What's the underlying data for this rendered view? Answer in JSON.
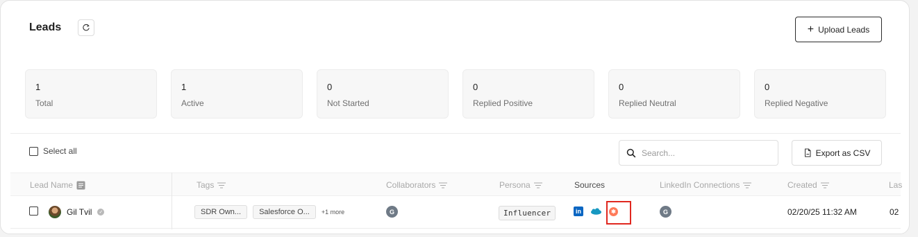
{
  "header": {
    "title": "Leads",
    "upload_label": "Upload Leads"
  },
  "stats": [
    {
      "value": "1",
      "label": "Total"
    },
    {
      "value": "1",
      "label": "Active"
    },
    {
      "value": "0",
      "label": "Not Started"
    },
    {
      "value": "0",
      "label": "Replied Positive"
    },
    {
      "value": "0",
      "label": "Replied Neutral"
    },
    {
      "value": "0",
      "label": "Replied Negative"
    }
  ],
  "toolbar": {
    "select_all_label": "Select all",
    "search_placeholder": "Search...",
    "export_label": "Export as CSV"
  },
  "table": {
    "columns": [
      "Lead Name",
      "Tags",
      "Collaborators",
      "Persona",
      "Sources",
      "LinkedIn Connections",
      "Created",
      "Las"
    ],
    "rows": [
      {
        "name": "Gil Tvil",
        "tags": [
          "SDR Own...",
          "Salesforce O..."
        ],
        "more_tags": "+1 more",
        "collaborator_initial": "G",
        "persona": "Influencer",
        "sources": [
          "linkedin-icon",
          "salesforce-icon",
          "hubspot-icon"
        ],
        "linkedin_connection_initial": "G",
        "created": "02/20/25 11:32 AM",
        "last": "02"
      }
    ]
  },
  "colors": {
    "linkedin": "#0a66c2",
    "salesforce": "#1798c1",
    "hubspot": "#ff7a59",
    "highlight": "#e0271f"
  }
}
